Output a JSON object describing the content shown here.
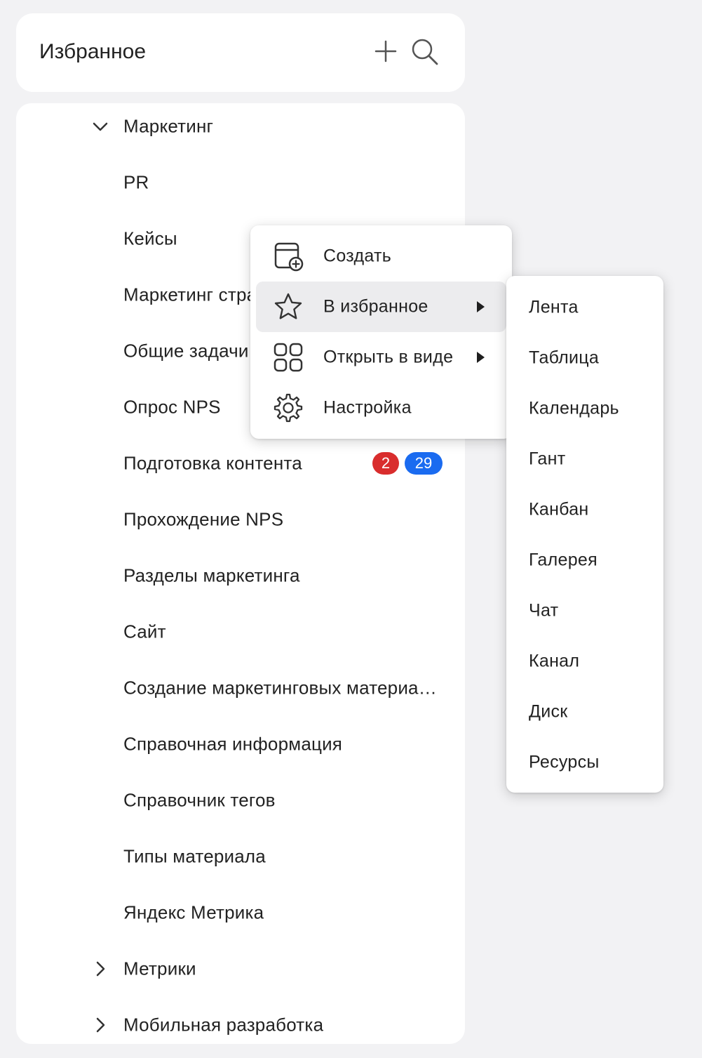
{
  "header": {
    "title": "Избранное",
    "add_icon": "plus-icon",
    "search_icon": "search-icon"
  },
  "tree": {
    "items": [
      {
        "label": "Маркетинг",
        "expander": "chevron-down"
      },
      {
        "label": "PR"
      },
      {
        "label": "Кейсы"
      },
      {
        "label": "Маркетинг стратегия"
      },
      {
        "label": "Общие задачи"
      },
      {
        "label": "Опрос NPS"
      },
      {
        "label": "Подготовка контента",
        "badges": [
          "2",
          "29"
        ]
      },
      {
        "label": "Прохождение NPS"
      },
      {
        "label": "Разделы маркетинга"
      },
      {
        "label": "Сайт"
      },
      {
        "label": "Создание маркетинговых материалов"
      },
      {
        "label": "Справочная информация"
      },
      {
        "label": "Справочник тегов"
      },
      {
        "label": "Типы материала"
      },
      {
        "label": "Яндекс Метрика"
      },
      {
        "label": "Метрики",
        "expander": "chevron-right"
      },
      {
        "label": "Мобильная разработка",
        "expander": "chevron-right"
      }
    ]
  },
  "context_menu": {
    "items": [
      {
        "label": "Создать",
        "icon": "calendar-plus-icon"
      },
      {
        "label": "В избранное",
        "icon": "star-icon",
        "has_submenu": true,
        "active": true
      },
      {
        "label": "Открыть в виде",
        "icon": "grid-icon",
        "has_submenu": true
      },
      {
        "label": "Настройка",
        "icon": "gear-icon"
      }
    ]
  },
  "submenu": {
    "items": [
      "Лента",
      "Таблица",
      "Календарь",
      "Гант",
      "Канбан",
      "Галерея",
      "Чат",
      "Канал",
      "Диск",
      "Ресурсы"
    ]
  },
  "colors": {
    "badge_red": "#d92d2d",
    "badge_blue": "#1a6bf0",
    "active_bg": "#ececee",
    "icon_stroke": "#333333"
  }
}
